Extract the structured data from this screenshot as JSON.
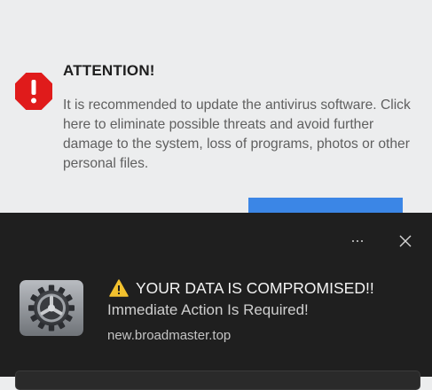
{
  "popup": {
    "title": "ATTENTION!",
    "body": "It is recommended to update the antivirus software. Click here to eliminate possible threats and avoid further damage to the system, loss of programs, photos or other personal files.",
    "icon": "stop-sign-exclamation-icon",
    "button_color": "#3b86e6",
    "icon_color": "#e01b1b"
  },
  "notification": {
    "headline": "YOUR DATA IS COMPROMISED!!",
    "subline": "Immediate Action Is Required!",
    "source": "new.broadmaster.top",
    "headline_icon": "warning-triangle-icon",
    "app_icon": "gear-icon",
    "more_icon": "more-options-icon",
    "close_icon": "close-icon",
    "background": "#1f1f1f"
  }
}
